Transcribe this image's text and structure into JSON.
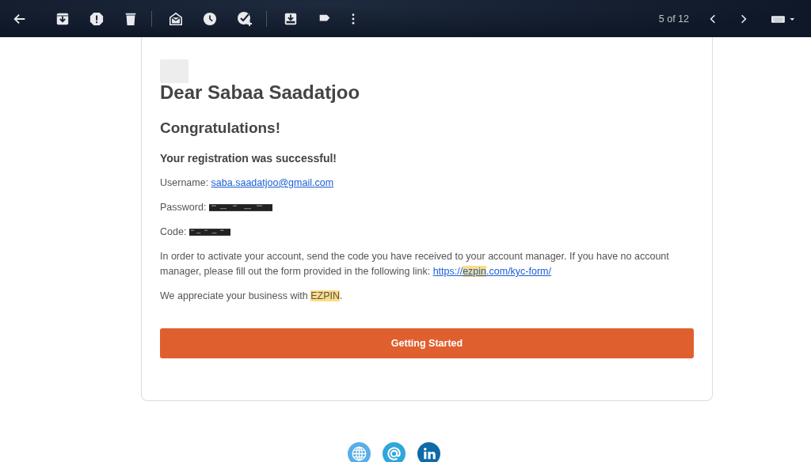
{
  "toolbar": {
    "counter": "5 of 12"
  },
  "email": {
    "heading": "Dear Sabaa Saadatjoo",
    "congrats": "Congratulations!",
    "subheading": "Your registration was successful!",
    "fields": [
      {
        "label": "Username: ",
        "kind": "link",
        "value": "saba.saadatjoo@gmail.com"
      },
      {
        "label": "Password: ",
        "kind": "redacted"
      },
      {
        "label": "Code: ",
        "kind": "redacted"
      }
    ],
    "instructions": {
      "text": "In order to activate your account, send the code you have received to your account manager. If you have no account manager, please fill out the form provided in the following link: ",
      "link": [
        {
          "text": "https://",
          "highlighted": false
        },
        {
          "text": "ezpin",
          "highlighted": true
        },
        {
          "text": ".com/kyc-form/",
          "highlighted": false
        }
      ]
    },
    "closing": [
      {
        "text": "We appreciate your business with ",
        "highlighted": false
      },
      {
        "text": "EZPIN",
        "highlighted": true
      },
      {
        "text": ".",
        "highlighted": false
      }
    ],
    "button": "Getting Started"
  }
}
